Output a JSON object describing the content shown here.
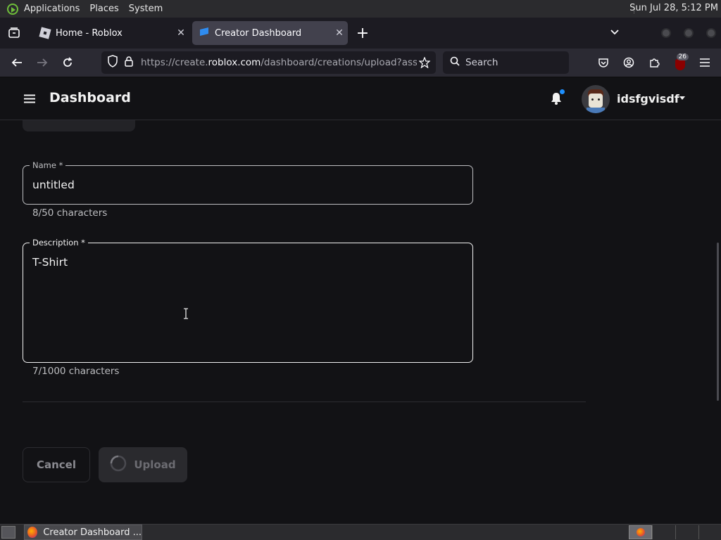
{
  "system_bar": {
    "menus": [
      "Applications",
      "Places",
      "System"
    ],
    "clock": "Sun Jul 28,  5:12 PM"
  },
  "browser": {
    "tabs": [
      {
        "label": "Home - Roblox",
        "active": false
      },
      {
        "label": "Creator Dashboard",
        "active": true
      }
    ],
    "url_prefix": "https://create.",
    "url_domain": "roblox.com",
    "url_path": "/dashboard/creations/upload?asset",
    "search_placeholder": "Search",
    "extension_badge": "26"
  },
  "app": {
    "title": "Dashboard",
    "username": "idsfgvisdf"
  },
  "form": {
    "name_label": "Name *",
    "name_value": "untitled",
    "name_counter": "8/50 characters",
    "description_label": "Description *",
    "description_value": "T-Shirt",
    "description_counter": "7/1000 characters",
    "cancel_label": "Cancel",
    "upload_label": "Upload"
  },
  "taskbar": {
    "window_label": "Creator Dashboard ..."
  },
  "colors": {
    "accent_blue": "#0a84ff",
    "page_bg": "#121215",
    "notification_dot": "#1e90ff"
  }
}
